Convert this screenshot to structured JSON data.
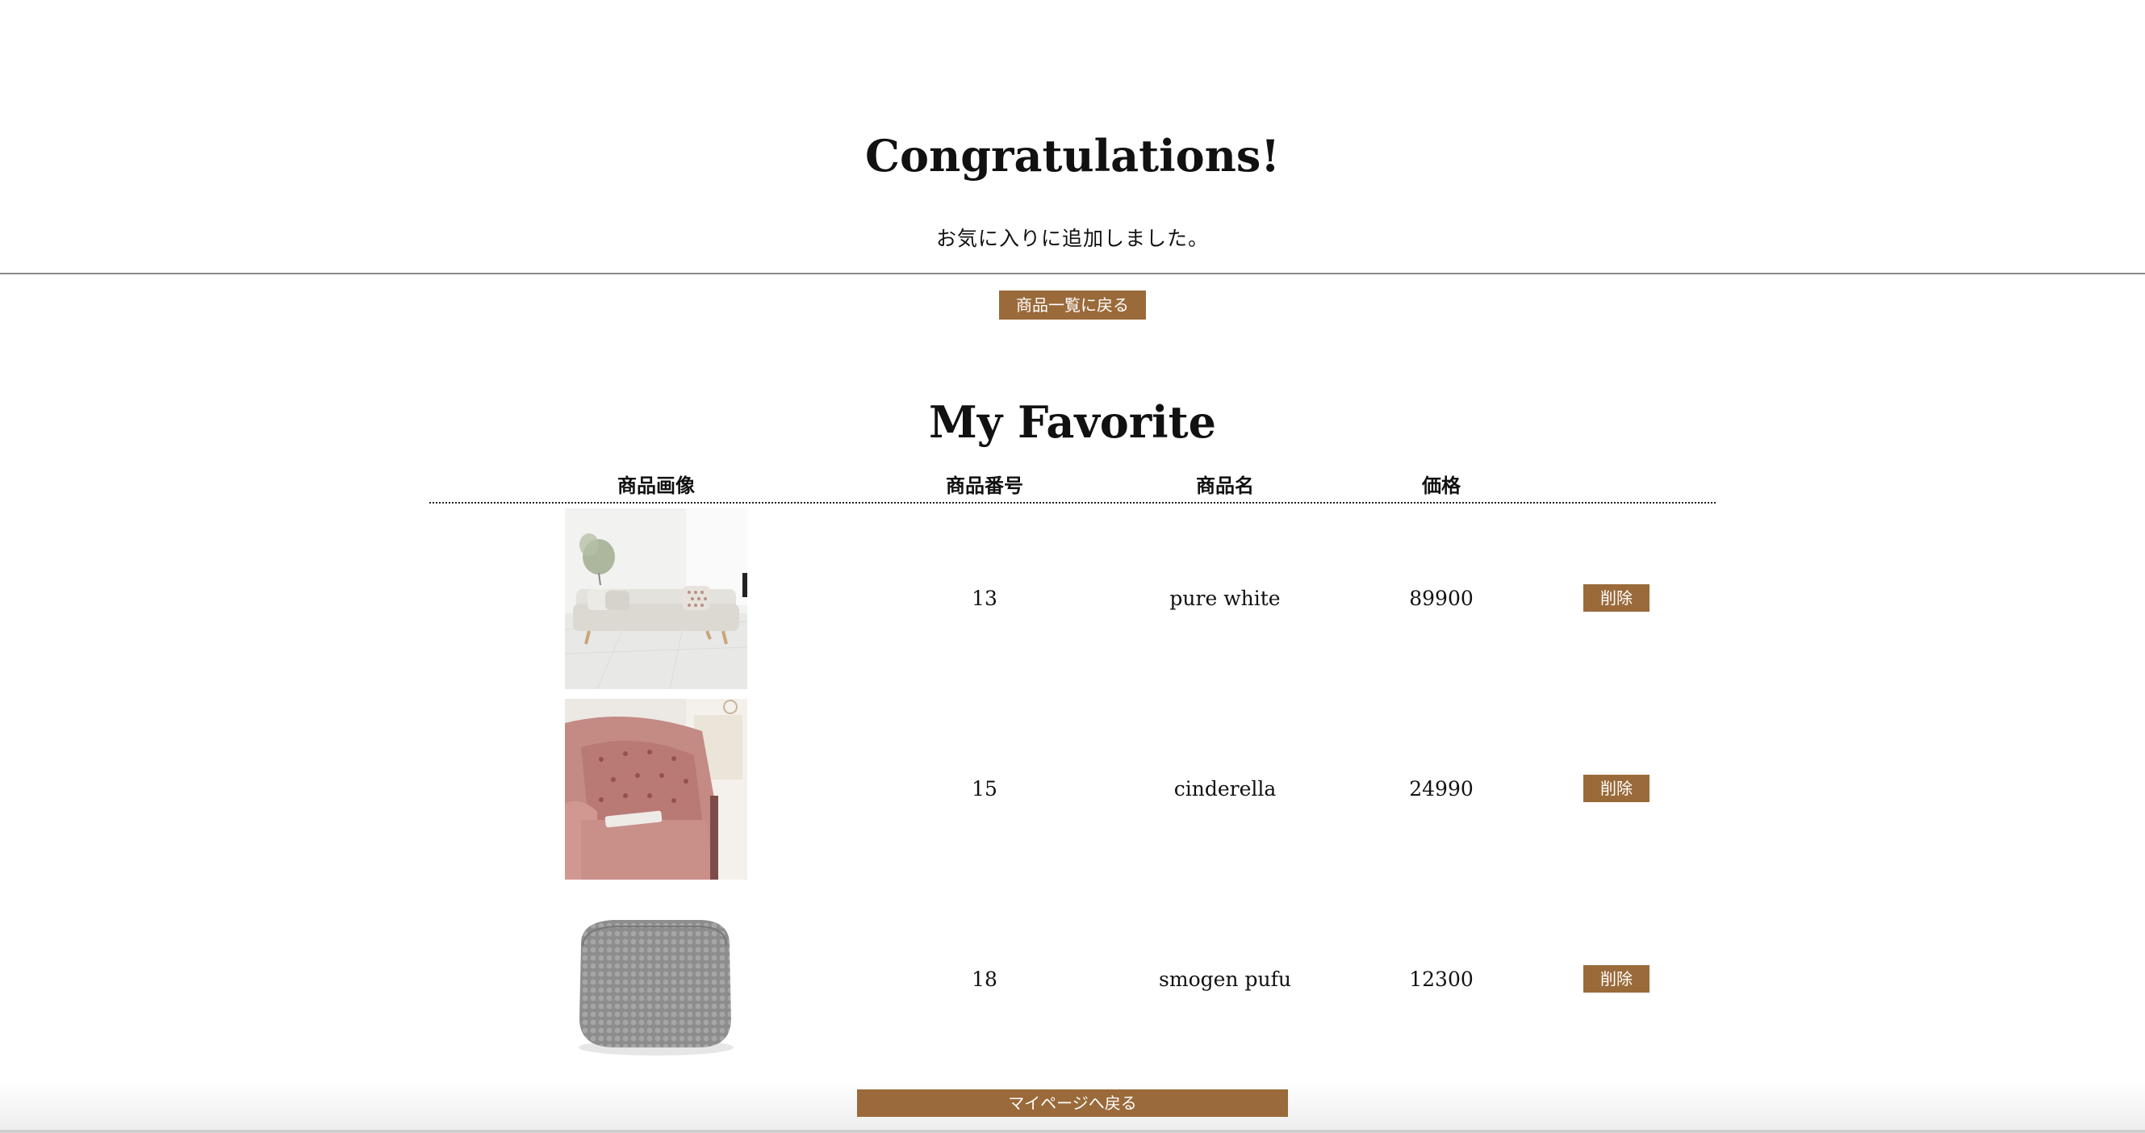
{
  "nav": {
    "items": [
      "",
      "",
      "",
      ""
    ]
  },
  "congrats": {
    "title": "Congratulations!",
    "message": "お気に入りに追加しました。",
    "back_to_list_label": "商品一覧に戻る"
  },
  "favorites": {
    "title": "My Favorite",
    "columns": {
      "image": "商品画像",
      "number": "商品番号",
      "name": "商品名",
      "price": "価格"
    },
    "delete_label": "削除",
    "rows": [
      {
        "number": "13",
        "name": "pure white",
        "price": "89900",
        "image": "white-sofa-image"
      },
      {
        "number": "15",
        "name": "cinderella",
        "price": "24990",
        "image": "pink-armchair-image"
      },
      {
        "number": "18",
        "name": "smogen pufu",
        "price": "12300",
        "image": "grey-knit-pouf-image"
      }
    ]
  },
  "footer": {
    "back_to_mypage_label": "マイページへ戻る"
  },
  "colors": {
    "button": "#9a6a3a",
    "button_text": "#ffffff"
  }
}
